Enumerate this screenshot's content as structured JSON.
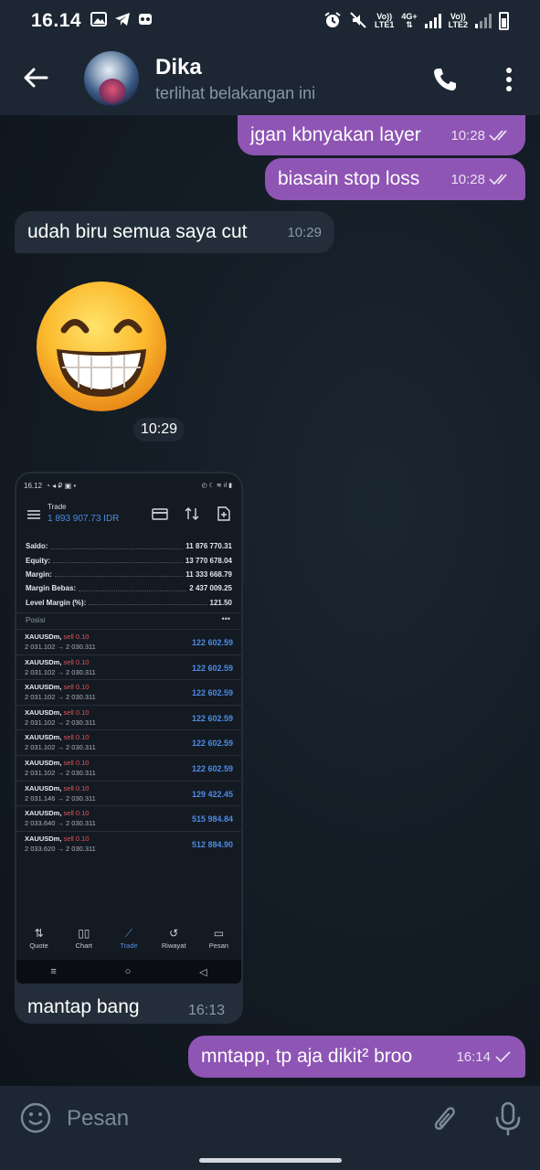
{
  "status_bar": {
    "time": "16.14",
    "sim1": "LTE1",
    "sim2": "LTE2",
    "net": "4G+",
    "volte": "Vo))"
  },
  "header": {
    "contact_name": "Dika",
    "status": "terlihat belakangan ini"
  },
  "messages": [
    {
      "dir": "out",
      "text": "jgan kbnyakan layer",
      "time": "10:28",
      "checks": "read"
    },
    {
      "dir": "out",
      "text": "biasain stop loss",
      "time": "10:28",
      "checks": "read"
    },
    {
      "dir": "in",
      "text": "udah biru semua saya cut",
      "time": "10:29"
    },
    {
      "dir": "in",
      "type": "emoji",
      "emoji_name": "grinning-face-with-smiling-eyes",
      "time": "10:29"
    },
    {
      "dir": "in",
      "type": "image",
      "caption": "mantap bang",
      "time": "16:13"
    },
    {
      "dir": "out",
      "text": "mntapp, tp aja dikit² broo",
      "time": "16:14",
      "checks": "sent"
    }
  ],
  "screenshot": {
    "status_time": "16.12",
    "title": "Trade",
    "balance": "1 893 907.73 IDR",
    "account": [
      {
        "label": "Saldo:",
        "value": "11 876 770.31"
      },
      {
        "label": "Equity:",
        "value": "13 770 678.04"
      },
      {
        "label": "Margin:",
        "value": "11 333 668.79"
      },
      {
        "label": "Margin Bebas:",
        "value": "2 437 009.25"
      },
      {
        "label": "Level Margin (%):",
        "value": "121.50"
      }
    ],
    "positions_label": "Posisi",
    "positions": [
      {
        "symbol": "XAUUSDm,",
        "side": "sell 0.10",
        "prices": "2 031.102 → 2 030.311",
        "profit": "122 602.59"
      },
      {
        "symbol": "XAUUSDm,",
        "side": "sell 0.10",
        "prices": "2 031.102 → 2 030.311",
        "profit": "122 602.59"
      },
      {
        "symbol": "XAUUSDm,",
        "side": "sell 0.10",
        "prices": "2 031.102 → 2 030.311",
        "profit": "122 602.59"
      },
      {
        "symbol": "XAUUSDm,",
        "side": "sell 0.10",
        "prices": "2 031.102 → 2 030.311",
        "profit": "122 602.59"
      },
      {
        "symbol": "XAUUSDm,",
        "side": "sell 0.10",
        "prices": "2 031.102 → 2 030.311",
        "profit": "122 602.59"
      },
      {
        "symbol": "XAUUSDm,",
        "side": "sell 0.10",
        "prices": "2 031.102 → 2 030.311",
        "profit": "122 602.59"
      },
      {
        "symbol": "XAUUSDm,",
        "side": "sell 0.10",
        "prices": "2 031.146 → 2 030.311",
        "profit": "129 422.45"
      },
      {
        "symbol": "XAUUSDm,",
        "side": "sell 0.10",
        "prices": "2 033.640 → 2 030.311",
        "profit": "515 984.84"
      },
      {
        "symbol": "XAUUSDm,",
        "side": "sell 0.10",
        "prices": "2 033.620 → 2 030.311",
        "profit": "512 884.90"
      }
    ],
    "nav": [
      "Quote",
      "Chart",
      "Trade",
      "Riwayat",
      "Pesan"
    ],
    "active_nav": "Trade"
  },
  "input": {
    "placeholder": "Pesan"
  },
  "colors": {
    "outgoing_bubble": "#8e55b4",
    "incoming_bubble": "#232e3a",
    "header_bg": "#1c2733",
    "accent_blue": "#4d8be0"
  }
}
